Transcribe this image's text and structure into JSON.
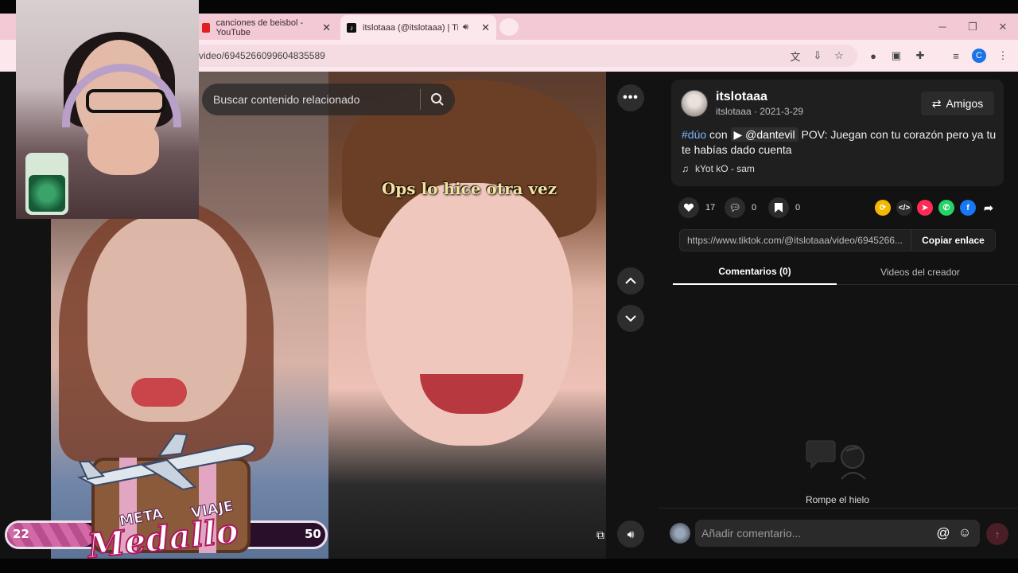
{
  "browser": {
    "tabs": [
      {
        "label": "canciones de beisbol - YouTube",
        "icon": "youtube-icon"
      },
      {
        "label": "itslotaaa (@itslotaaa) | TikT",
        "icon": "tiktok-icon"
      }
    ],
    "address": "video/6945266099604835589"
  },
  "video": {
    "search_placeholder": "Buscar contenido relacionado",
    "overlay_text": "Ops lo hice otra vez"
  },
  "stream_overlay": {
    "progress_start": "22",
    "progress_end": "50",
    "meta_label": "META",
    "viaje_label": "VIAJE",
    "title": "Medallo"
  },
  "post": {
    "username": "itslotaaa",
    "subline": "itslotaaa · 2021-3-29",
    "friends_label": "Amigos",
    "hashtag": "#dúo",
    "with_word": "con",
    "mention": "@dantevil",
    "caption": "POV: Juegan con tu corazón pero ya tu te habías dado cuenta",
    "music": "kYot kO - sam",
    "likes": "17",
    "comments": "0",
    "saves": "0",
    "link": "https://www.tiktok.com/@itslotaaa/video/6945266...",
    "copy_label": "Copiar enlace"
  },
  "panel_tabs": [
    {
      "label": "Comentarios (0)",
      "active": true
    },
    {
      "label": "Videos del creador",
      "active": false
    }
  ],
  "empty_state": "Rompe el hielo",
  "comment_placeholder": "Añadir comentario...",
  "colors": {
    "tab_strip": "#f2c9d4",
    "accent_pink": "#fe2c55",
    "hashtag_blue": "#7fb5ff"
  }
}
